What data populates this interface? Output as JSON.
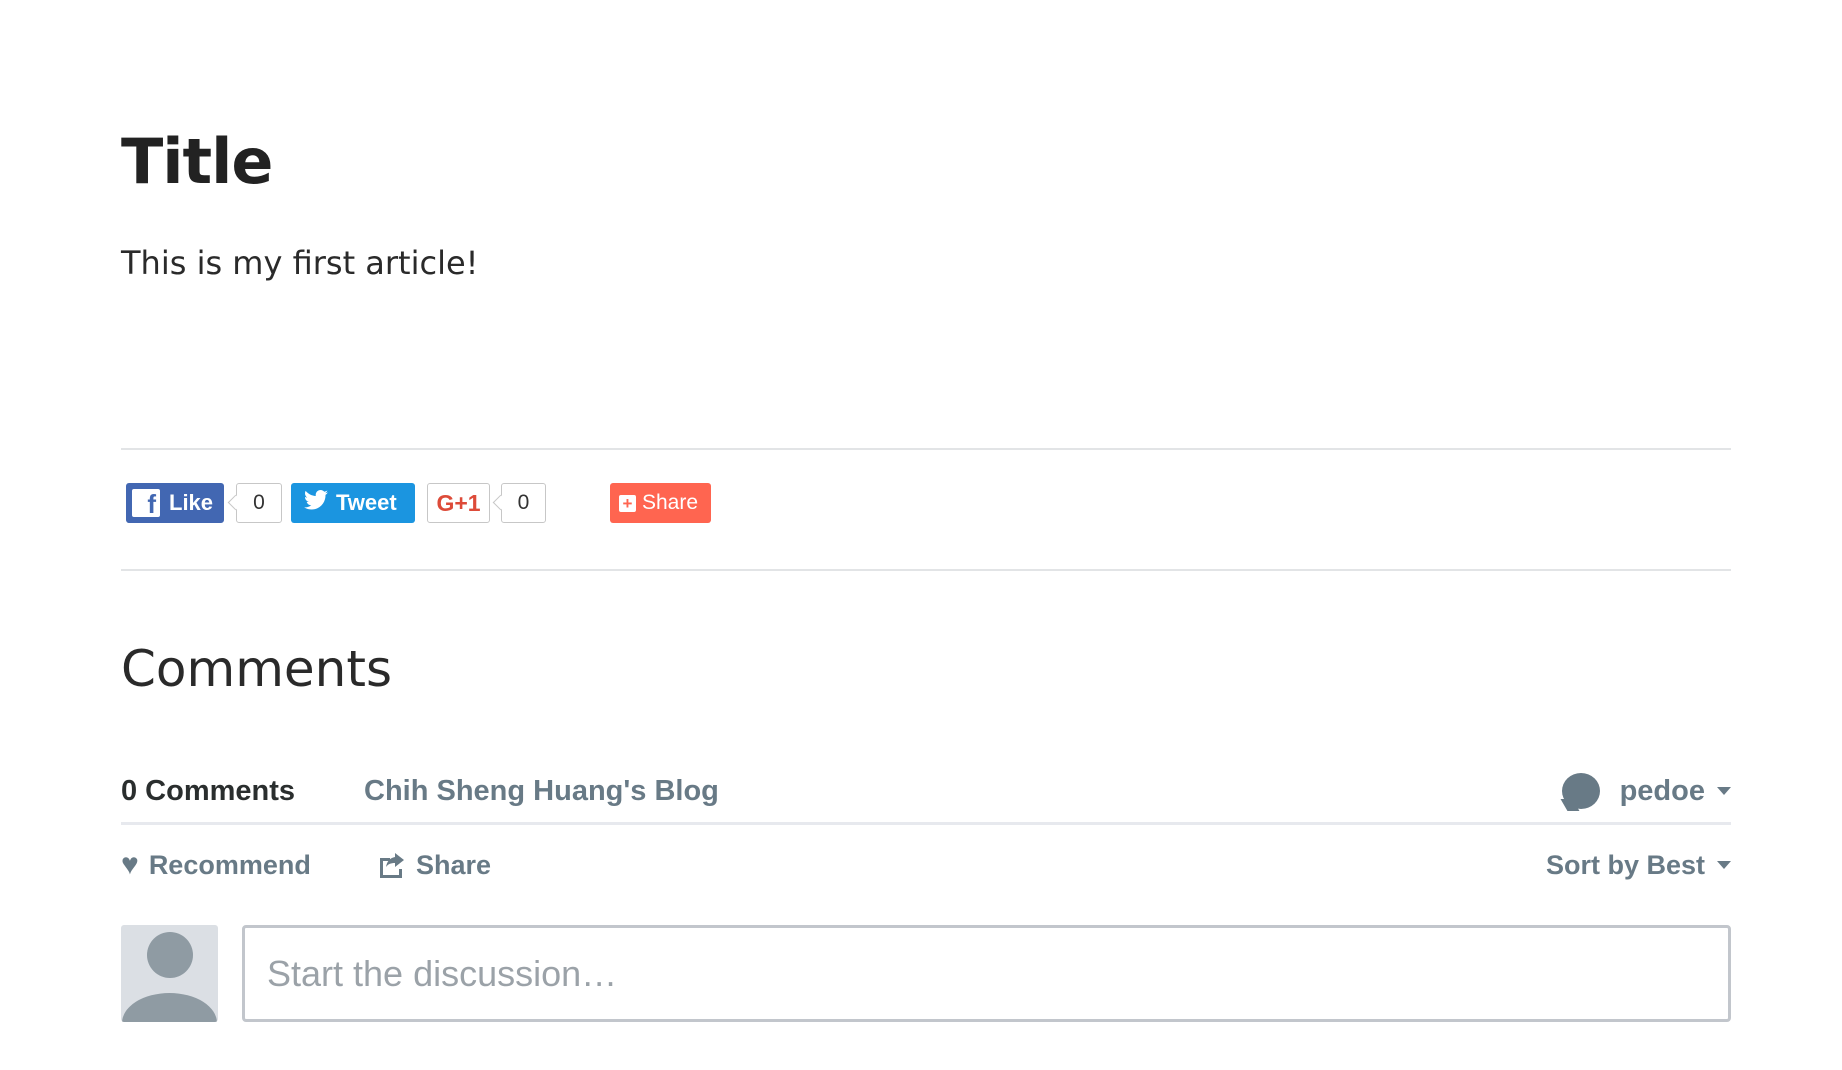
{
  "article": {
    "title": "Title",
    "body": "This is my first article!"
  },
  "share_bar": {
    "facebook": {
      "label": "Like",
      "count": "0",
      "icon": "facebook-icon"
    },
    "twitter": {
      "label": "Tweet",
      "icon": "twitter-bird-icon"
    },
    "google_plus": {
      "label": "G+1",
      "count": "0"
    },
    "addthis": {
      "label": "Share",
      "icon": "plus-icon"
    }
  },
  "comments": {
    "heading": "Comments",
    "tabs": {
      "count_tab": "0 Comments",
      "site_tab": "Chih Sheng Huang's Blog"
    },
    "user": {
      "name": "pedoe",
      "icon": "chat-bubble-icon"
    },
    "actions": {
      "recommend": "Recommend",
      "share": "Share",
      "sort": "Sort by Best"
    },
    "composer": {
      "placeholder": "Start the discussion…"
    }
  },
  "colors": {
    "facebook": "#4267b2",
    "twitter": "#1b95e0",
    "addthis": "#ff6550",
    "disqus_muted": "#687a86",
    "active_tab": "#2e9fff"
  }
}
